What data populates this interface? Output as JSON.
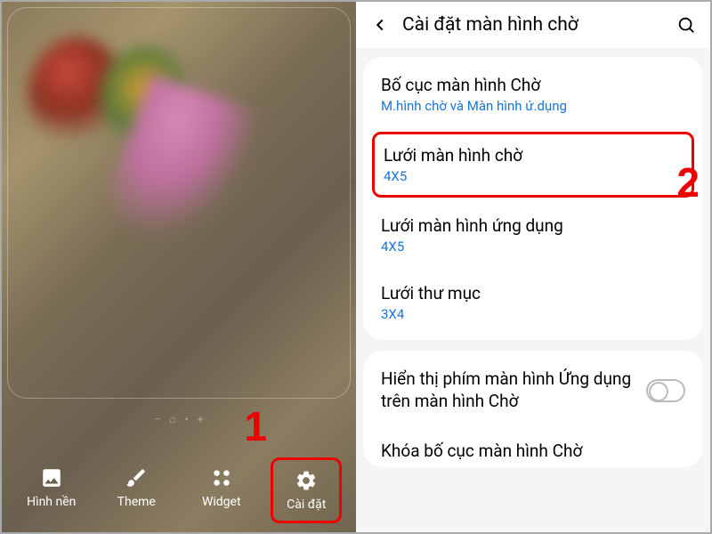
{
  "left": {
    "toolbar": [
      {
        "label": "Hình nền",
        "icon": "image-icon"
      },
      {
        "label": "Theme",
        "icon": "brush-icon"
      },
      {
        "label": "Widget",
        "icon": "grid-icon"
      },
      {
        "label": "Cài đặt",
        "icon": "gear-icon"
      }
    ]
  },
  "right": {
    "header_title": "Cài đặt màn hình chờ",
    "group1": [
      {
        "title": "Bố cục màn hình Chờ",
        "value": "M.hình chờ và Màn hình ứ.dụng"
      },
      {
        "title": "Lưới màn hình chờ",
        "value": "4X5"
      },
      {
        "title": "Lưới màn hình ứng dụng",
        "value": "4X5"
      },
      {
        "title": "Lưới thư mục",
        "value": "3X4"
      }
    ],
    "group2": {
      "toggle_title": "Hiển thị phím màn hình Ứng dụng trên màn hình Chờ",
      "partial_title": "Khóa bố cục màn hình Chờ"
    }
  },
  "steps": {
    "one": "1",
    "two": "2"
  }
}
